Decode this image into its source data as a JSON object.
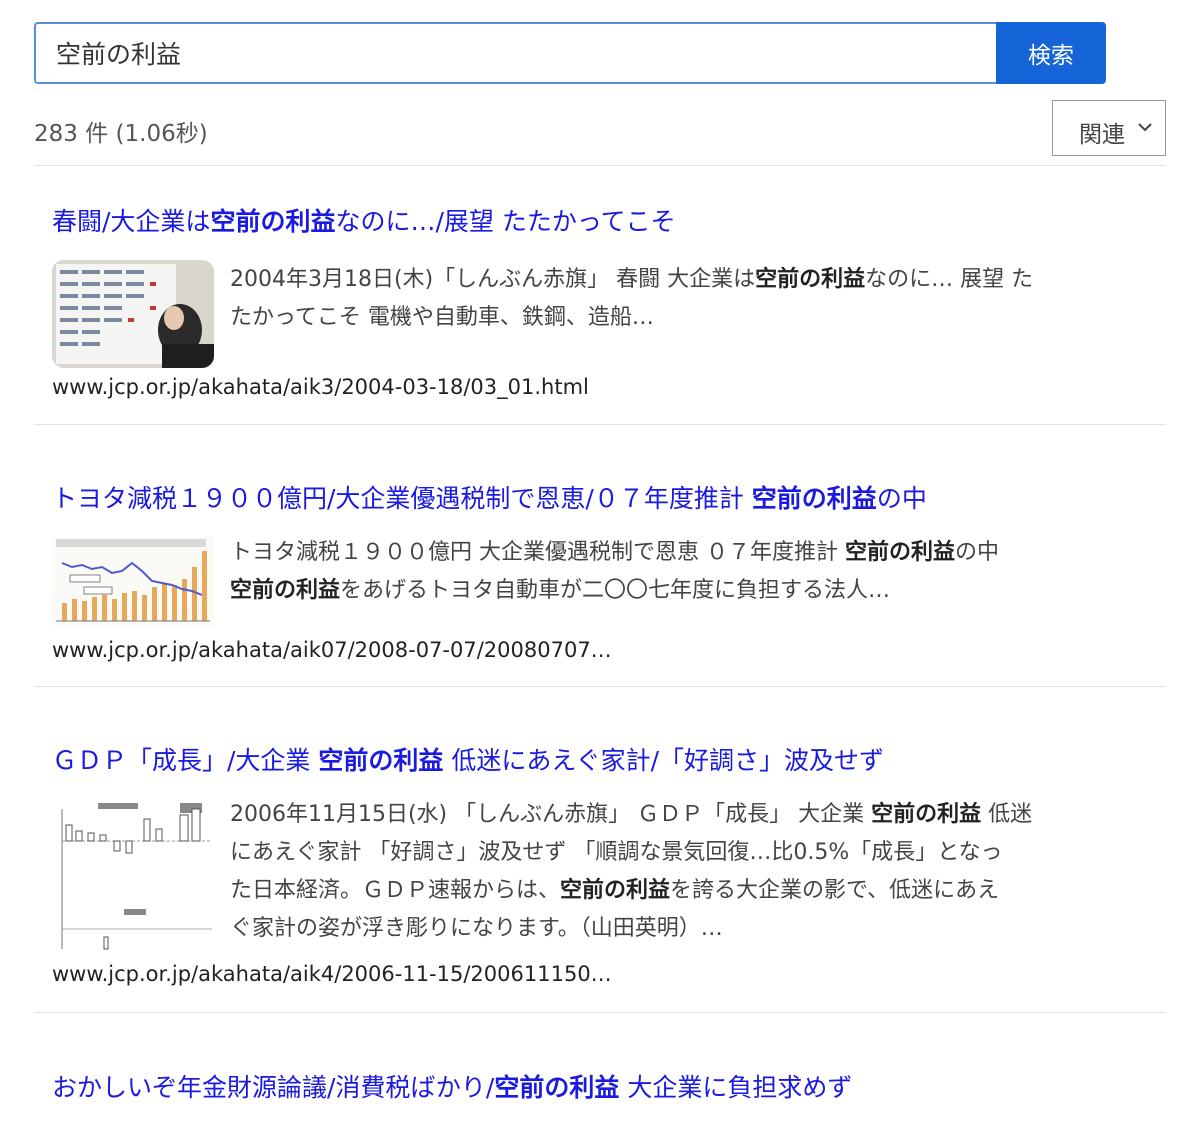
{
  "search": {
    "query": "空前の利益",
    "button_label": "検索"
  },
  "meta": {
    "count": "283 件",
    "time": "(1.06秒)",
    "sort_label": "関連"
  },
  "results": [
    {
      "title_parts": [
        "春闘/大企業は",
        "空前の利益",
        "なのに…/展望 たたかってこそ"
      ],
      "snippet_lines": [
        [
          "2004年3月18日(木)「しんぶん赤旗」 春闘 大企業は",
          "空前の利益",
          "なのに… 展望 た"
        ],
        [
          "たかってこそ 電機や自動車、鉄鋼、造船…"
        ]
      ],
      "url": "www.jcp.or.jp/akahata/aik3/2004-03-18/03_01.html",
      "thumb_icon": "photo-thumbnail-icon"
    },
    {
      "title_parts": [
        "トヨタ減税１９００億円/大企業優遇税制で恩恵/０７年度推計 ",
        "空前の利益",
        "の中"
      ],
      "snippet_lines": [
        [
          "トヨタ減税１９００億円 大企業優遇税制で恩恵 ０７年度推計 ",
          "空前の利益",
          "の中"
        ],
        [
          "",
          "空前の利益",
          "をあげるトヨタ自動車が二〇〇七年度に負担する法人…"
        ]
      ],
      "url": "www.jcp.or.jp/akahata/aik07/2008-07-07/20080707…",
      "thumb_icon": "chart-thumbnail-icon"
    },
    {
      "title_parts": [
        "ＧＤＰ「成長」/大企業 ",
        "空前の利益",
        " 低迷にあえぐ家計/「好調さ」波及せず"
      ],
      "snippet_lines": [
        [
          "2006年11月15日(水) 「しんぶん赤旗」 ＧＤＰ「成長」 大企業 ",
          "空前の利益",
          " 低迷"
        ],
        [
          "にあえぐ家計 「好調さ」波及せず 「順調な景気回復…比0.5%「成長」となっ"
        ],
        [
          "た日本経済。ＧＤＰ速報からは、",
          "空前の利益",
          "を誇る大企業の影で、低迷にあえ"
        ],
        [
          "ぐ家計の姿が浮き彫りになります。（山田英明）…"
        ]
      ],
      "url": "www.jcp.or.jp/akahata/aik4/2006-11-15/200611150…",
      "thumb_icon": "bar-chart-thumbnail-icon"
    },
    {
      "title_parts": [
        "おかしいぞ年金財源論議/消費税ばかり/",
        "空前の利益",
        " 大企業に負担求めず"
      ],
      "snippet_lines": [],
      "url": "",
      "thumb_icon": "document-thumbnail-icon"
    }
  ],
  "colors": {
    "accent": "#1565d8",
    "link": "#1a1ae0",
    "input_border": "#5b8ed6"
  }
}
